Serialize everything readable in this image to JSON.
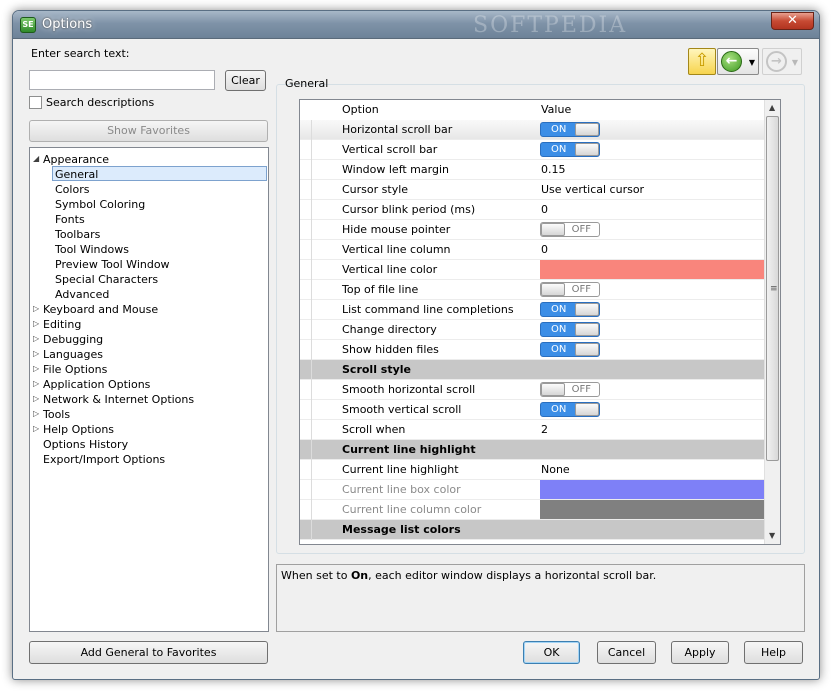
{
  "window": {
    "title": "Options",
    "app_icon_text": "SE",
    "watermark": "SOFTPEDIA",
    "close_glyph": "✕"
  },
  "search": {
    "label": "Enter search text:",
    "value": "",
    "placeholder": "",
    "clear_label": "Clear",
    "search_descriptions_label": "Search descriptions",
    "search_descriptions_checked": false,
    "show_favorites_label": "Show Favorites"
  },
  "tree": {
    "items": [
      {
        "label": "Appearance",
        "expanded": true
      },
      {
        "label": "General",
        "selected": true
      },
      {
        "label": "Colors"
      },
      {
        "label": "Symbol Coloring"
      },
      {
        "label": "Fonts"
      },
      {
        "label": "Toolbars"
      },
      {
        "label": "Tool Windows"
      },
      {
        "label": "Preview Tool Window"
      },
      {
        "label": "Special Characters"
      },
      {
        "label": "Advanced"
      },
      {
        "label": "Keyboard and Mouse",
        "expanded": false
      },
      {
        "label": "Editing",
        "expanded": false
      },
      {
        "label": "Debugging",
        "expanded": false
      },
      {
        "label": "Languages",
        "expanded": false
      },
      {
        "label": "File Options",
        "expanded": false
      },
      {
        "label": "Application Options",
        "expanded": false
      },
      {
        "label": "Network & Internet Options",
        "expanded": false
      },
      {
        "label": "Tools",
        "expanded": false
      },
      {
        "label": "Help Options",
        "expanded": false
      },
      {
        "label": "Options History"
      },
      {
        "label": "Export/Import Options"
      }
    ],
    "expanded_glyph": "◢",
    "collapsed_glyph": "▷"
  },
  "nav": {
    "up_icon": "up-arrow-icon",
    "up_glyph": "⇧",
    "back_glyph": "←",
    "forward_glyph": "→",
    "drop_glyph": "▼"
  },
  "panel": {
    "group_label": "General",
    "columns": {
      "option": "Option",
      "value": "Value"
    },
    "rows": [
      {
        "option": "Horizontal scroll bar",
        "type": "toggle",
        "value": "ON",
        "on": true,
        "selected": true
      },
      {
        "option": "Vertical scroll bar",
        "type": "toggle",
        "value": "ON",
        "on": true
      },
      {
        "option": "Window left margin",
        "type": "text",
        "value": "0.15"
      },
      {
        "option": "Cursor style",
        "type": "text",
        "value": "Use vertical cursor"
      },
      {
        "option": "Cursor blink period (ms)",
        "type": "text",
        "value": "0"
      },
      {
        "option": "Hide mouse pointer",
        "type": "toggle",
        "value": "OFF",
        "on": false
      },
      {
        "option": "Vertical line column",
        "type": "text",
        "value": "0"
      },
      {
        "option": "Vertical line color",
        "type": "color",
        "value": "#f9857c"
      },
      {
        "option": "Top of file line",
        "type": "toggle",
        "value": "OFF",
        "on": false
      },
      {
        "option": "List command line completions",
        "type": "toggle",
        "value": "ON",
        "on": true
      },
      {
        "option": "Change directory",
        "type": "toggle",
        "value": "ON",
        "on": true
      },
      {
        "option": "Show hidden files",
        "type": "toggle",
        "value": "ON",
        "on": true
      },
      {
        "option": "Scroll style",
        "type": "section"
      },
      {
        "option": "Smooth horizontal scroll",
        "type": "toggle",
        "value": "OFF",
        "on": false
      },
      {
        "option": "Smooth vertical scroll",
        "type": "toggle",
        "value": "ON",
        "on": true
      },
      {
        "option": "Scroll when",
        "type": "text",
        "value": "2"
      },
      {
        "option": "Current line highlight",
        "type": "section"
      },
      {
        "option": "Current line highlight",
        "type": "text",
        "value": "None"
      },
      {
        "option": "Current line box color",
        "type": "color",
        "value": "#7e80f7",
        "disabled": true
      },
      {
        "option": "Current line column color",
        "type": "color",
        "value": "#808080",
        "disabled": true
      },
      {
        "option": "Message list colors",
        "type": "section"
      }
    ],
    "scroll_up_glyph": "▲",
    "scroll_down_glyph": "▼",
    "scroll_grip_glyph": "≡"
  },
  "description": {
    "prefix": "When set to ",
    "emphasis": "On",
    "suffix": ", each editor window displays a horizontal scroll bar."
  },
  "buttons": {
    "add_favorites": "Add General to Favorites",
    "ok": "OK",
    "cancel": "Cancel",
    "apply": "Apply",
    "help": "Help"
  }
}
